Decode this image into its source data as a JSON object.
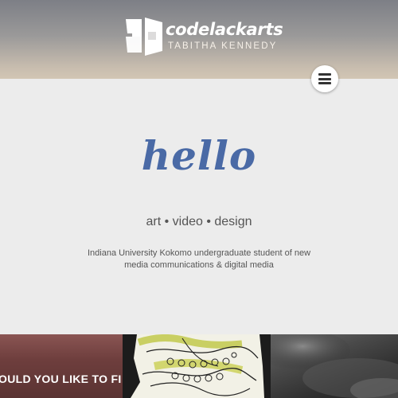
{
  "header": {
    "logo_icon": "book-house-logo-icon",
    "brand": "codelackarts",
    "author": "TABITHA KENNEDY",
    "menu_icon": "hamburger-menu-icon"
  },
  "hero": {
    "greeting": "hello",
    "tagline": "art • video • design",
    "description": "Indiana University Kokomo undergraduate student of new media communications & digital media"
  },
  "tiles": {
    "tile1_text": "OULD YOU LIKE TO FI",
    "tile2_icon": "sketch-artwork-image",
    "tile3_icon": "stormy-landscape-image"
  },
  "colors": {
    "accent": "#4a6aa6",
    "hero_bg": "#ececec",
    "text": "#555555"
  }
}
